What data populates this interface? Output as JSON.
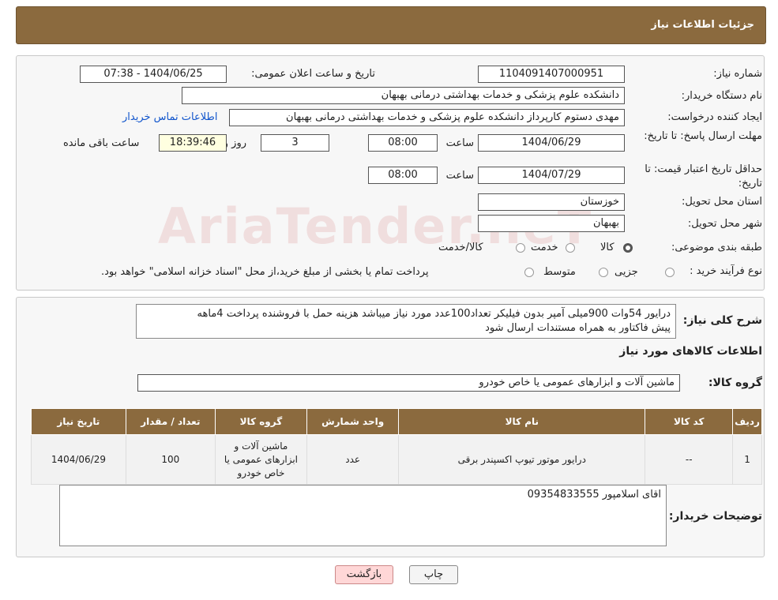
{
  "header": {
    "title": "جزئیات اطلاعات نیاز"
  },
  "watermark": "AriaTender.neT",
  "fields": {
    "need_no_label": "شماره نیاز:",
    "need_no": "1104091407000951",
    "announce_label": "تاریخ و ساعت اعلان عمومی:",
    "announce_value": "1404/06/25 - 07:38",
    "buyer_label": "نام دستگاه خریدار:",
    "buyer": "دانشکده علوم پزشکی و خدمات بهداشتی  درمانی بهبهان",
    "creator_label": "ایجاد کننده درخواست:",
    "creator": "مهدی دستوم کارپرداز دانشکده علوم پزشکی و خدمات بهداشتی  درمانی بهبهان",
    "contact_link": "اطلاعات تماس خریدار",
    "deadline_label": "مهلت ارسال پاسخ: تا تاریخ:",
    "deadline_date": "1404/06/29",
    "time_label": "ساعت",
    "deadline_time": "08:00",
    "days": "3",
    "days_label": "روز و",
    "remaining_time": "18:39:46",
    "remaining_label": "ساعت باقی مانده",
    "validity_label": "حداقل تاریخ اعتبار قیمت: تا تاریخ:",
    "validity_date": "1404/07/29",
    "validity_time": "08:00",
    "province_label": "استان محل تحویل:",
    "province": "خوزستان",
    "city_label": "شهر محل تحویل:",
    "city": "بهبهان",
    "category_label": "طبقه بندی موضوعی:",
    "category_options": [
      "کالا",
      "خدمت",
      "کالا/خدمت"
    ],
    "process_label": "نوع فرآیند خرید :",
    "process_options": [
      "جزیی",
      "متوسط"
    ],
    "process_note": "پرداخت تمام یا بخشی از مبلغ خرید،از محل \"اسناد خزانه اسلامی\" خواهد بود."
  },
  "summary": {
    "label": "شرح کلی نیاز:",
    "text_line1": "درایور 54وات 900میلی آمپر بدون فیلیکر تعداد100عدد مورد نیاز میباشد هزینه حمل با فروشنده پرداخت 4ماهه",
    "text_line2": "پیش فاکتاور به همراه مستندات ارسال شود",
    "items_title": "اطلاعات کالاهای مورد نیاز",
    "group_label": "گروه کالا:",
    "group_value": "ماشین آلات و ابزارهای عمومی یا خاص خودرو"
  },
  "table": {
    "headers": [
      "ردیف",
      "کد کالا",
      "نام کالا",
      "واحد شمارش",
      "گروه کالا",
      "تعداد / مقدار",
      "تاریخ نیاز"
    ],
    "rows": [
      [
        "1",
        "--",
        "درایور موتور تیوپ اکسپندر برقی",
        "عدد",
        "ماشین آلات و ابزارهای عمومی یا خاص خودرو",
        "100",
        "1404/06/29"
      ]
    ]
  },
  "buyer_notes": {
    "label": "توضیحات خریدار:",
    "text": "اقای اسلامپور 09354833555"
  },
  "buttons": {
    "print": "چاپ",
    "back": "بازگشت"
  }
}
